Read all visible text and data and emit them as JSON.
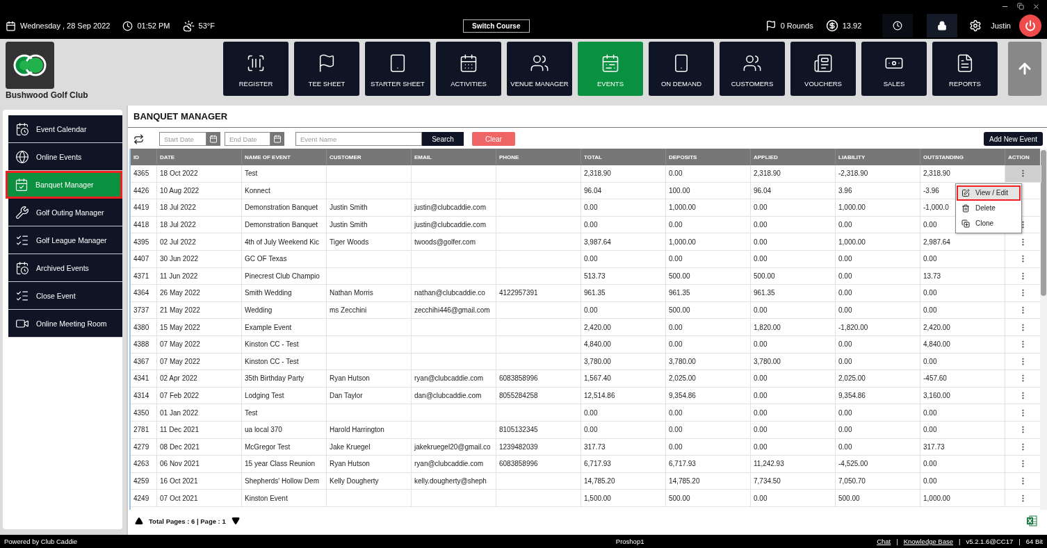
{
  "top_bar": {
    "date": "Wednesday ,  28 Sep 2022",
    "time": "01:52 PM",
    "weather": "53°F",
    "switch_button": "Switch Course",
    "rounds": "0 Rounds",
    "balance": "13.92",
    "user": "Justin"
  },
  "club": {
    "name": "Bushwood Golf Club"
  },
  "nav": [
    {
      "label": "REGISTER",
      "selected": false
    },
    {
      "label": "TEE SHEET",
      "selected": false
    },
    {
      "label": "STARTER SHEET",
      "selected": false
    },
    {
      "label": "ACTIVITIES",
      "selected": false
    },
    {
      "label": "VENUE MANAGER",
      "selected": false
    },
    {
      "label": "EVENTS",
      "selected": true
    },
    {
      "label": "ON DEMAND",
      "selected": false
    },
    {
      "label": "CUSTOMERS",
      "selected": false
    },
    {
      "label": "VOUCHERS",
      "selected": false
    },
    {
      "label": "SALES",
      "selected": false
    },
    {
      "label": "REPORTS",
      "selected": false
    }
  ],
  "sidebar": [
    {
      "label": "Event Calendar",
      "selected": false,
      "highlighted": false
    },
    {
      "label": "Online Events",
      "selected": false,
      "highlighted": false
    },
    {
      "label": "Banquet Manager",
      "selected": true,
      "highlighted": true
    },
    {
      "label": "Golf Outing Manager",
      "selected": false,
      "highlighted": false
    },
    {
      "label": "Golf League Manager",
      "selected": false,
      "highlighted": false
    },
    {
      "label": "Archived Events",
      "selected": false,
      "highlighted": false
    },
    {
      "label": "Close Event",
      "selected": false,
      "highlighted": false
    },
    {
      "label": "Online Meeting Room",
      "selected": false,
      "highlighted": false
    }
  ],
  "page": {
    "title": "BANQUET MANAGER"
  },
  "filters": {
    "start_placeholder": "Start Date",
    "end_placeholder": "End Date",
    "name_placeholder": "Event Name",
    "search": "Search",
    "clear": "Clear",
    "add": "Add New Event"
  },
  "table": {
    "columns": [
      "ID",
      "DATE",
      "NAME OF EVENT",
      "CUSTOMER",
      "EMAIL",
      "PHONE",
      "TOTAL",
      "DEPOSITS",
      "APPLIED",
      "LIABILITY",
      "OUTSTANDING",
      "ACTION"
    ],
    "rows": [
      {
        "cells": [
          "4365",
          "18 Oct 2022",
          "Test",
          "",
          "",
          "",
          "2,318.90",
          "0.00",
          "2,318.90",
          "-2,318.90",
          "2,318.90"
        ],
        "menu_open": true
      },
      {
        "cells": [
          "4426",
          "10 Aug 2022",
          "Konnect",
          "",
          "",
          "",
          "96.04",
          "100.00",
          "96.04",
          "3.96",
          "-3.96"
        ],
        "menu_open": false
      },
      {
        "cells": [
          "4419",
          "18 Jul 2022",
          "Demonstration Banquet",
          "Justin Smith",
          "justin@clubcaddie.com",
          "",
          "0.00",
          "1,000.00",
          "0.00",
          "1,000.00",
          "-1,000.0"
        ],
        "menu_open": false
      },
      {
        "cells": [
          "4418",
          "18 Jul 2022",
          "Demonstration Banquet",
          "Justin Smith",
          "justin@clubcaddie.com",
          "",
          "0.00",
          "0.00",
          "0.00",
          "0.00",
          "0.00"
        ],
        "menu_open": false
      },
      {
        "cells": [
          "4395",
          "02 Jul 2022",
          "4th of July Weekend Kic",
          "Tiger Woods",
          "twoods@golfer.com",
          "",
          "3,987.64",
          "1,000.00",
          "0.00",
          "1,000.00",
          "2,987.64"
        ],
        "menu_open": false
      },
      {
        "cells": [
          "4407",
          "30 Jun 2022",
          "GC OF Texas",
          "",
          "",
          "",
          "0.00",
          "0.00",
          "0.00",
          "0.00",
          "0.00"
        ],
        "menu_open": false
      },
      {
        "cells": [
          "4371",
          "11 Jun 2022",
          "Pinecrest Club Champio",
          "",
          "",
          "",
          "513.73",
          "500.00",
          "500.00",
          "0.00",
          "13.73"
        ],
        "menu_open": false
      },
      {
        "cells": [
          "4364",
          "26 May 2022",
          "Smith Wedding",
          " Nathan Morris",
          "nathan@clubcaddie.co",
          "4122957391",
          "961.35",
          "961.35",
          "961.35",
          "0.00",
          "0.00"
        ],
        "menu_open": false
      },
      {
        "cells": [
          "3737",
          "21 May 2022",
          "Wedding",
          "ms Zecchini",
          "zecchihi446@gmail.com",
          "",
          "0.00",
          "500.00",
          "0.00",
          "0.00",
          "0.00"
        ],
        "menu_open": false
      },
      {
        "cells": [
          "4380",
          "15 May 2022",
          "Example Event",
          "",
          "",
          "",
          "2,420.00",
          "0.00",
          "1,820.00",
          "-1,820.00",
          "2,420.00"
        ],
        "menu_open": false
      },
      {
        "cells": [
          "4388",
          "07 May 2022",
          "Kinston CC - Test",
          "",
          "",
          "",
          "4,840.00",
          "0.00",
          "0.00",
          "0.00",
          "4,840.00"
        ],
        "menu_open": false
      },
      {
        "cells": [
          "4367",
          "07 May 2022",
          "Kinston CC - Test",
          "",
          "",
          "",
          "3,780.00",
          "3,780.00",
          "3,780.00",
          "0.00",
          "0.00"
        ],
        "menu_open": false
      },
      {
        "cells": [
          "4341",
          "02 Apr 2022",
          "35th Birthday Party",
          "Ryan Hutson",
          "ryan@clubcaddie.com",
          "6083858996",
          "1,567.40",
          "2,025.00",
          "0.00",
          "2,025.00",
          "-457.60"
        ],
        "menu_open": false
      },
      {
        "cells": [
          "4314",
          "07 Feb 2022",
          "Lodging Test",
          "Dan Taylor",
          "dan@clubcaddie.com",
          "8055284258",
          "12,514.86",
          "9,354.86",
          "0.00",
          "9,354.86",
          "3,160.00"
        ],
        "menu_open": false
      },
      {
        "cells": [
          "4350",
          "01 Jan 2022",
          "Test",
          "",
          "",
          "",
          "0.00",
          "0.00",
          "0.00",
          "0.00",
          "0.00"
        ],
        "menu_open": false
      },
      {
        "cells": [
          "2781",
          "11 Dec 2021",
          "ua local 370",
          "Harold Harrington",
          "",
          "8105132345",
          "0.00",
          "0.00",
          "0.00",
          "0.00",
          "0.00"
        ],
        "menu_open": false
      },
      {
        "cells": [
          "4279",
          "08 Dec 2021",
          "McGregor Test",
          "Jake Kruegel",
          "jakekruegel20@gmail.co",
          "1239482039",
          "317.73",
          "0.00",
          "0.00",
          "0.00",
          "317.73"
        ],
        "menu_open": false
      },
      {
        "cells": [
          "4263",
          "06 Nov 2021",
          "15 year Class Reunion",
          "Ryan Hutson",
          "ryan@clubcaddie.com",
          "6083858996",
          "6,717.93",
          "6,717.93",
          "11,242.93",
          "-4,525.00",
          "0.00"
        ],
        "menu_open": false
      },
      {
        "cells": [
          "4259",
          "16 Oct 2021",
          "Shepherds' Hollow Dem",
          "Kelly Dougherty",
          "kelly.dougherty@sheph",
          "",
          "14,785.20",
          "14,785.20",
          "7,734.50",
          "7,050.70",
          "0.00"
        ],
        "menu_open": false
      },
      {
        "cells": [
          "4249",
          "07 Oct 2021",
          "Kinston Event",
          "",
          "",
          "",
          "1,500.00",
          "500.00",
          "0.00",
          "500.00",
          "1,000.00"
        ],
        "menu_open": false
      }
    ]
  },
  "context_menu": {
    "items": [
      {
        "label": "View / Edit",
        "highlighted": true
      },
      {
        "label": "Delete",
        "highlighted": false
      },
      {
        "label": "Clone",
        "highlighted": false
      }
    ]
  },
  "pager": {
    "text": "Total Pages : 6 | Page : 1"
  },
  "status_bar": {
    "left": "Powered by Club Caddie",
    "center": "Proshop1",
    "items": [
      {
        "kind": "link",
        "text": "Chat"
      },
      {
        "kind": "separator",
        "text": "|"
      },
      {
        "kind": "link",
        "text": "Knowledge Base"
      },
      {
        "kind": "separator",
        "text": "|"
      },
      {
        "kind": "text",
        "text": "v5.2.1.6@CC17"
      },
      {
        "kind": "separator",
        "text": "|"
      },
      {
        "kind": "text",
        "text": "64 Bit"
      }
    ]
  }
}
